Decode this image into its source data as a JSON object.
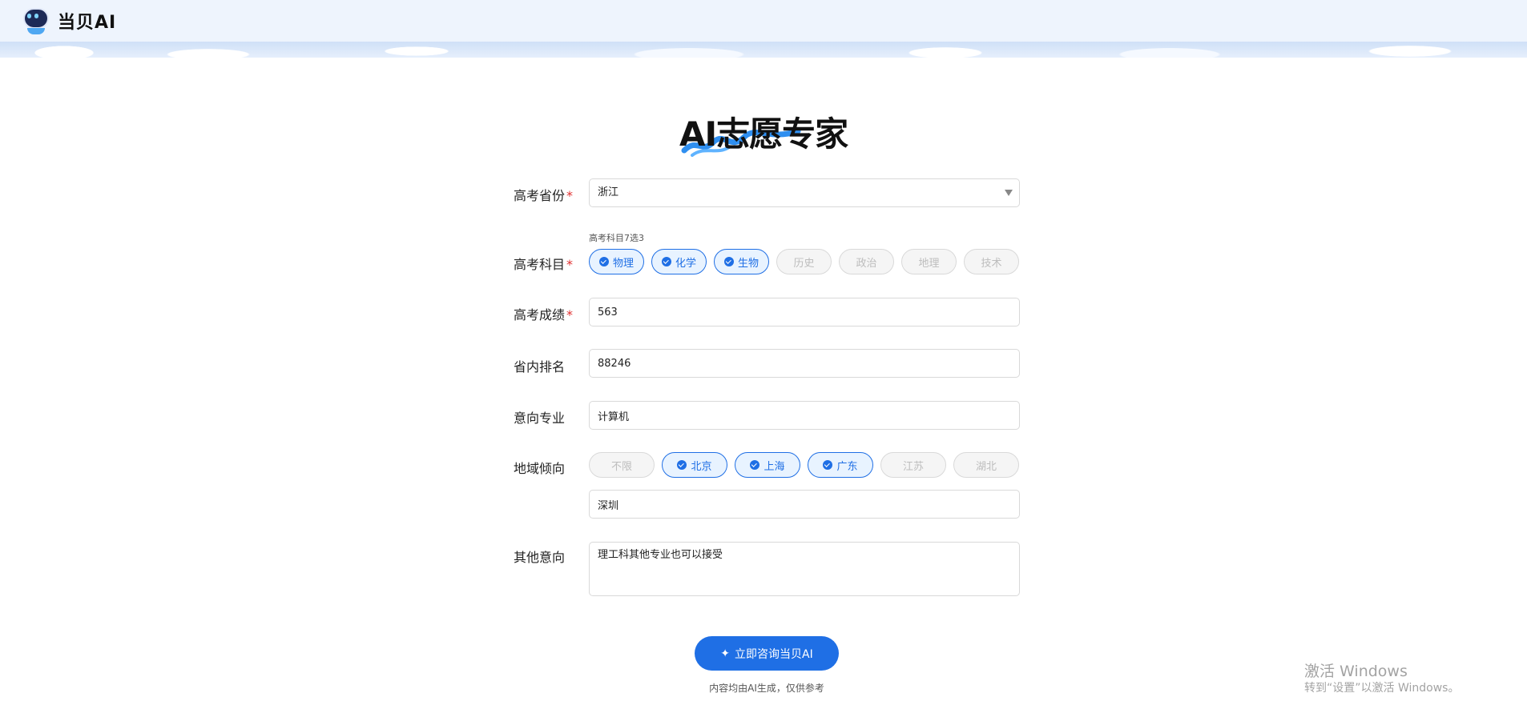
{
  "header": {
    "brand": "当贝AI"
  },
  "title": "AI志愿专家",
  "form": {
    "province": {
      "label": "高考省份",
      "value": "浙江"
    },
    "subjects": {
      "label": "高考科目",
      "hint": "高考科目7选3",
      "options": [
        {
          "label": "物理",
          "selected": true
        },
        {
          "label": "化学",
          "selected": true
        },
        {
          "label": "生物",
          "selected": true
        },
        {
          "label": "历史",
          "selected": false
        },
        {
          "label": "政治",
          "selected": false
        },
        {
          "label": "地理",
          "selected": false
        },
        {
          "label": "技术",
          "selected": false
        }
      ]
    },
    "score": {
      "label": "高考成绩",
      "value": "563"
    },
    "rank": {
      "label": "省内排名",
      "value": "88246"
    },
    "major": {
      "label": "意向专业",
      "value": "计算机"
    },
    "region": {
      "label": "地域倾向",
      "options": [
        {
          "label": "不限",
          "selected": false
        },
        {
          "label": "北京",
          "selected": true
        },
        {
          "label": "上海",
          "selected": true
        },
        {
          "label": "广东",
          "selected": true
        },
        {
          "label": "江苏",
          "selected": false
        },
        {
          "label": "湖北",
          "selected": false
        }
      ],
      "extra_value": "深圳"
    },
    "other": {
      "label": "其他意向",
      "value": "理工科其他专业也可以接受"
    }
  },
  "submit": {
    "label": "立即咨询当贝AI"
  },
  "disclaimer": "内容均由AI生成，仅供参考",
  "watermark": {
    "line1": "激活 Windows",
    "line2": "转到“设置”以激活 Windows。"
  },
  "colors": {
    "accent": "#1f6fe5",
    "required": "#e03030"
  }
}
